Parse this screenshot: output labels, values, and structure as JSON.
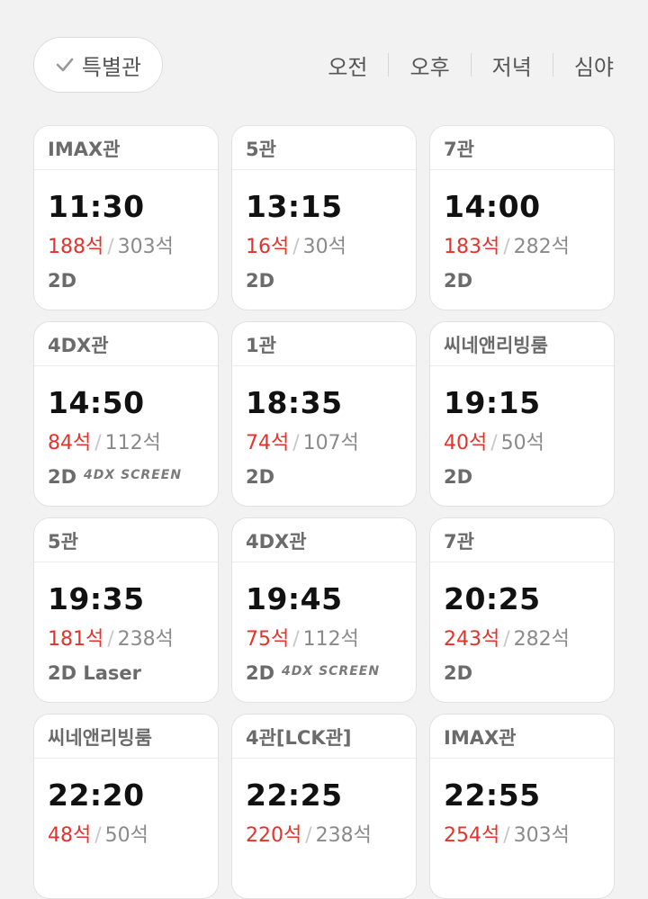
{
  "filters": {
    "special_label": "특별관",
    "check_icon": "check-icon",
    "time_tabs": [
      "오전",
      "오후",
      "저녁",
      "심야"
    ]
  },
  "colors": {
    "remaining_seats": "#e8312b",
    "total_seats": "#8a8a8a",
    "background": "#f2f2f2"
  },
  "showtimes": [
    {
      "hall": "IMAX관",
      "time": "11:30",
      "remaining": "188석",
      "total": "303석",
      "format": "2D",
      "logo": ""
    },
    {
      "hall": "5관",
      "time": "13:15",
      "remaining": "16석",
      "total": "30석",
      "format": "2D",
      "logo": ""
    },
    {
      "hall": "7관",
      "time": "14:00",
      "remaining": "183석",
      "total": "282석",
      "format": "2D",
      "logo": ""
    },
    {
      "hall": "4DX관",
      "time": "14:50",
      "remaining": "84석",
      "total": "112석",
      "format": "2D",
      "logo": "4DX SCREEN"
    },
    {
      "hall": "1관",
      "time": "18:35",
      "remaining": "74석",
      "total": "107석",
      "format": "2D",
      "logo": ""
    },
    {
      "hall": "씨네앤리빙룸",
      "time": "19:15",
      "remaining": "40석",
      "total": "50석",
      "format": "2D",
      "logo": ""
    },
    {
      "hall": "5관",
      "time": "19:35",
      "remaining": "181석",
      "total": "238석",
      "format": "2D Laser",
      "logo": ""
    },
    {
      "hall": "4DX관",
      "time": "19:45",
      "remaining": "75석",
      "total": "112석",
      "format": "2D",
      "logo": "4DX SCREEN"
    },
    {
      "hall": "7관",
      "time": "20:25",
      "remaining": "243석",
      "total": "282석",
      "format": "2D",
      "logo": ""
    },
    {
      "hall": "씨네앤리빙룸",
      "time": "22:20",
      "remaining": "48석",
      "total": "50석",
      "format": "",
      "logo": ""
    },
    {
      "hall": "4관[LCK관]",
      "time": "22:25",
      "remaining": "220석",
      "total": "238석",
      "format": "",
      "logo": ""
    },
    {
      "hall": "IMAX관",
      "time": "22:55",
      "remaining": "254석",
      "total": "303석",
      "format": "",
      "logo": ""
    }
  ]
}
